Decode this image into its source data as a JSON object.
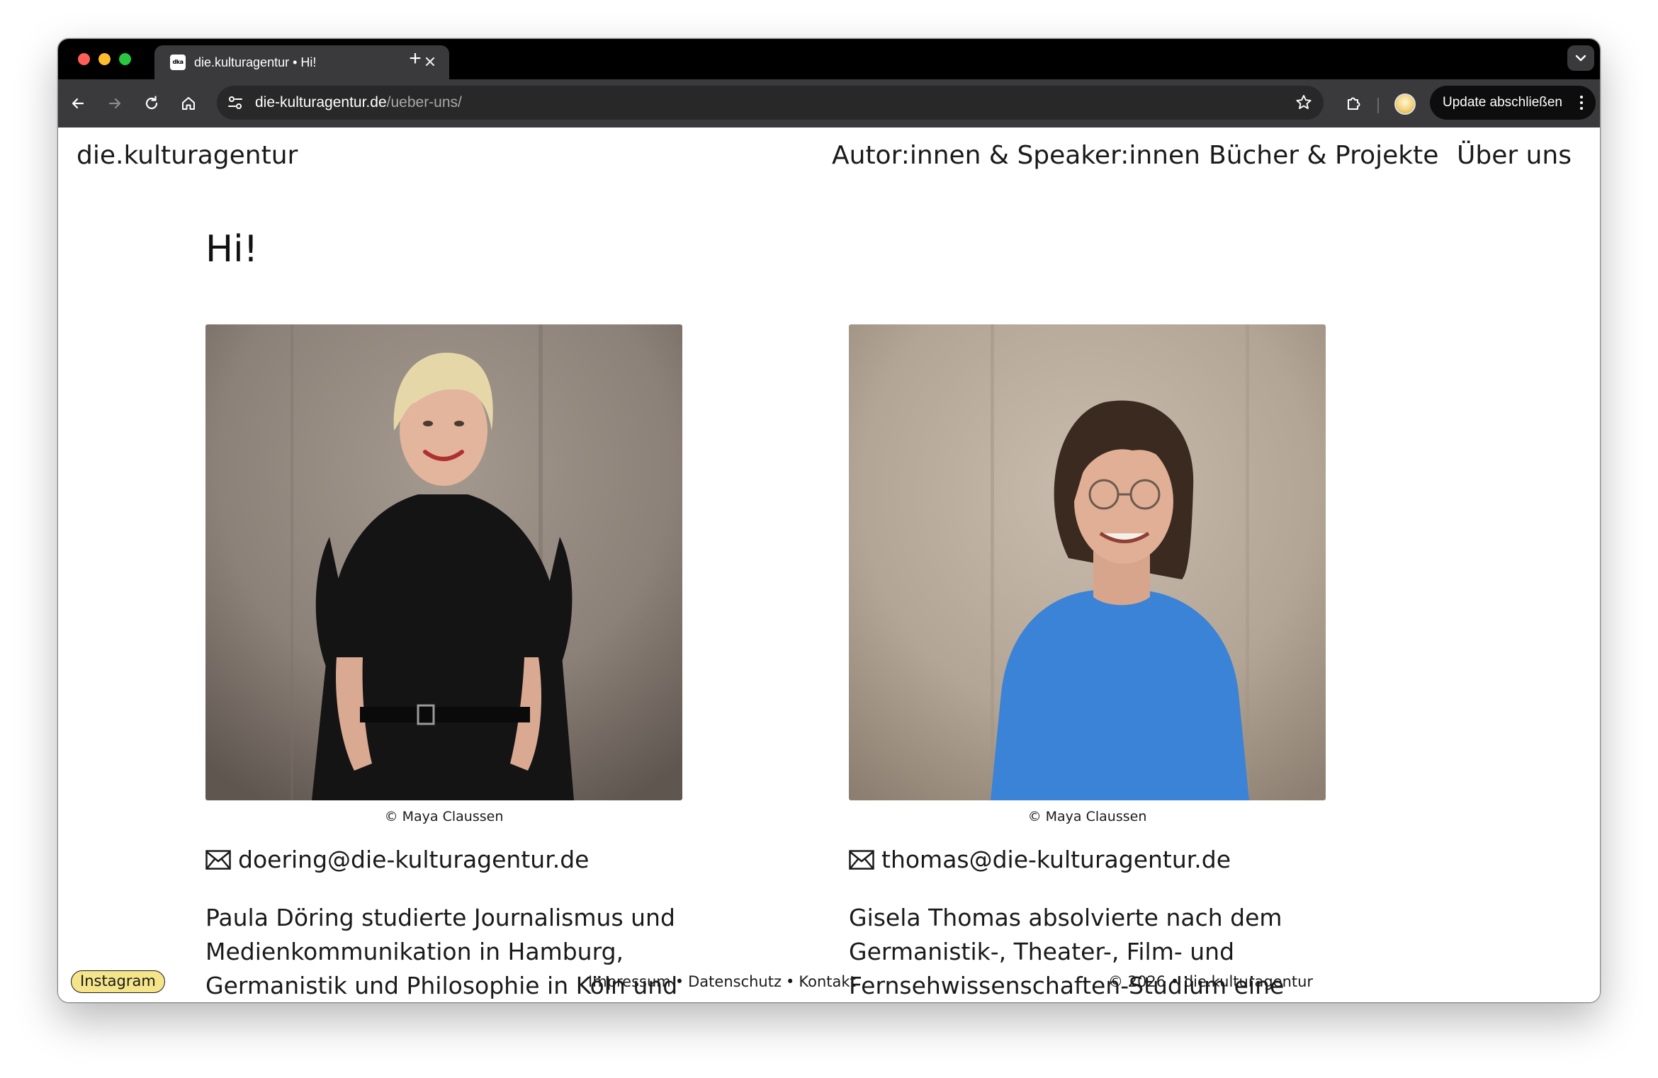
{
  "browser": {
    "tab": {
      "favicon_text": "dka",
      "title": "die.kulturagentur • Hi!"
    },
    "new_tab_label": "+",
    "address": {
      "host": "die-kulturagentur.de",
      "path": "/ueber-uns/"
    },
    "update_button": "Update abschließen"
  },
  "site": {
    "brand": "die.kulturagentur",
    "nav": [
      {
        "label": "Autor:innen & Speaker:innen"
      },
      {
        "label": "Bücher & Projekte"
      },
      {
        "label": "Über uns"
      }
    ]
  },
  "main": {
    "heading": "Hi!",
    "people": [
      {
        "photo_credit": "© Maya Claussen",
        "email": "doering@die-kulturagentur.de",
        "bio_lines": [
          "Paula Döring studierte Journalismus und",
          "Medienkommunikation in Hamburg,",
          "Germanistik und Philosophie in Köln und"
        ]
      },
      {
        "photo_credit": "© Maya Claussen",
        "email": "thomas@die-kulturagentur.de",
        "bio_lines": [
          "Gisela Thomas absolvierte nach dem",
          "Germanistik-, Theater-, Film- und",
          "Fernsehwissenschaften-Studium eine"
        ]
      }
    ]
  },
  "footer": {
    "instagram": "Instagram",
    "links": [
      "Impressum",
      "Datenschutz",
      "Kontakt"
    ],
    "separator": "•",
    "copyright": "© 2026 • die.kulturagentur"
  },
  "colors": {
    "instagram_badge": "#f4e58a",
    "chrome_dark": "#000000",
    "toolbar": "#3a3a3c",
    "page_text": "#1a1a1a",
    "photo_background": "#8f8278",
    "sweater_black": "#141414",
    "shirt_blue": "#3b83d6"
  }
}
